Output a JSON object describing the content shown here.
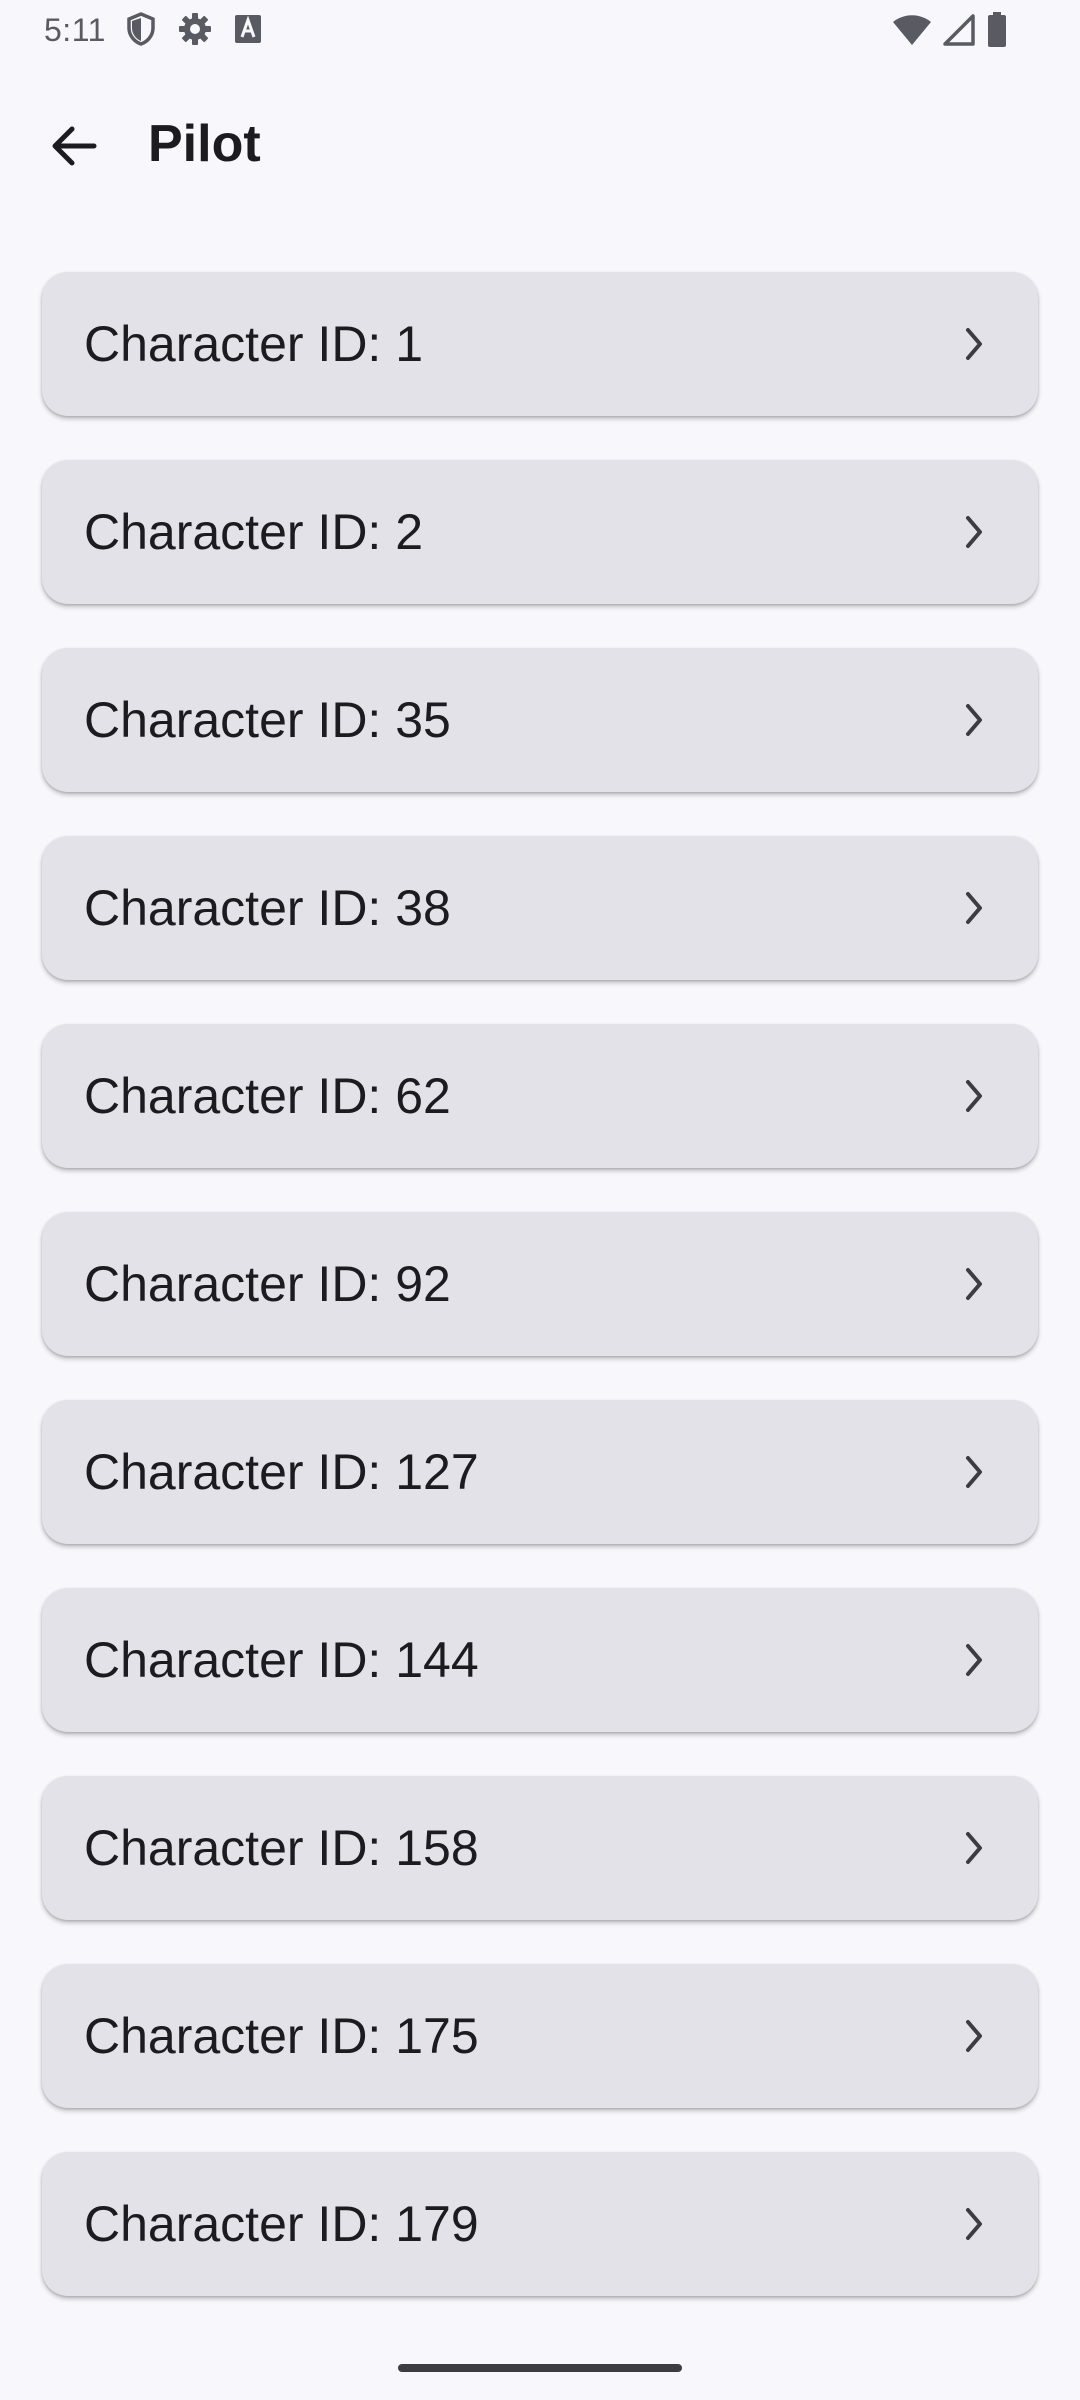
{
  "status_bar": {
    "time": "5:11",
    "left_icons": [
      "shield-icon",
      "gear-icon",
      "text-a-icon"
    ],
    "right_icons": [
      "wifi-icon",
      "signal-icon",
      "battery-icon"
    ]
  },
  "header": {
    "back_icon": "arrow-left-icon",
    "title": "Pilot"
  },
  "items": [
    {
      "label": "Character ID: 1"
    },
    {
      "label": "Character ID: 2"
    },
    {
      "label": "Character ID: 35"
    },
    {
      "label": "Character ID: 38"
    },
    {
      "label": "Character ID: 62"
    },
    {
      "label": "Character ID: 92"
    },
    {
      "label": "Character ID: 127"
    },
    {
      "label": "Character ID: 144"
    },
    {
      "label": "Character ID: 158"
    },
    {
      "label": "Character ID: 175"
    },
    {
      "label": "Character ID: 179"
    }
  ],
  "colors": {
    "background": "#f7f7fc",
    "card": "#e3e2e8",
    "text": "#1c1b20"
  }
}
